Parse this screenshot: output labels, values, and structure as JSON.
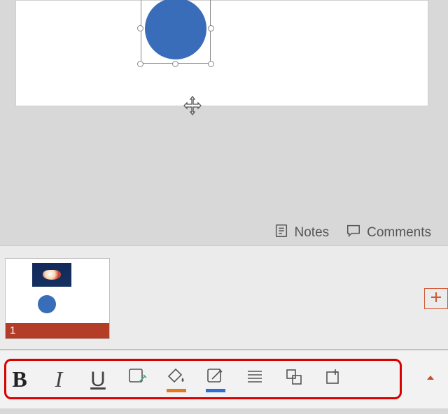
{
  "status": {
    "notes_label": "Notes",
    "comments_label": "Comments"
  },
  "thumbnails": [
    {
      "index": "1"
    }
  ],
  "icons": {
    "notes": "notes-icon",
    "comments": "comments-icon",
    "new_slide": "plus-icon",
    "bold": "bold-icon",
    "italic": "italic-icon",
    "underline": "underline-icon",
    "shape_style": "shape-style-icon",
    "fill_color": "fill-color-icon",
    "outline_color": "outline-color-icon",
    "align": "align-icon",
    "arrange": "arrange-icon",
    "insert": "insert-icon",
    "expand": "expand-up-icon"
  },
  "colors": {
    "shape_fill": "#3a6db9",
    "accent": "#d15a36",
    "fill_swatch": "#e07b1f",
    "outline_swatch": "#2f6fd0",
    "highlight_box": "#d80000",
    "thumb_band": "#b33d27"
  }
}
